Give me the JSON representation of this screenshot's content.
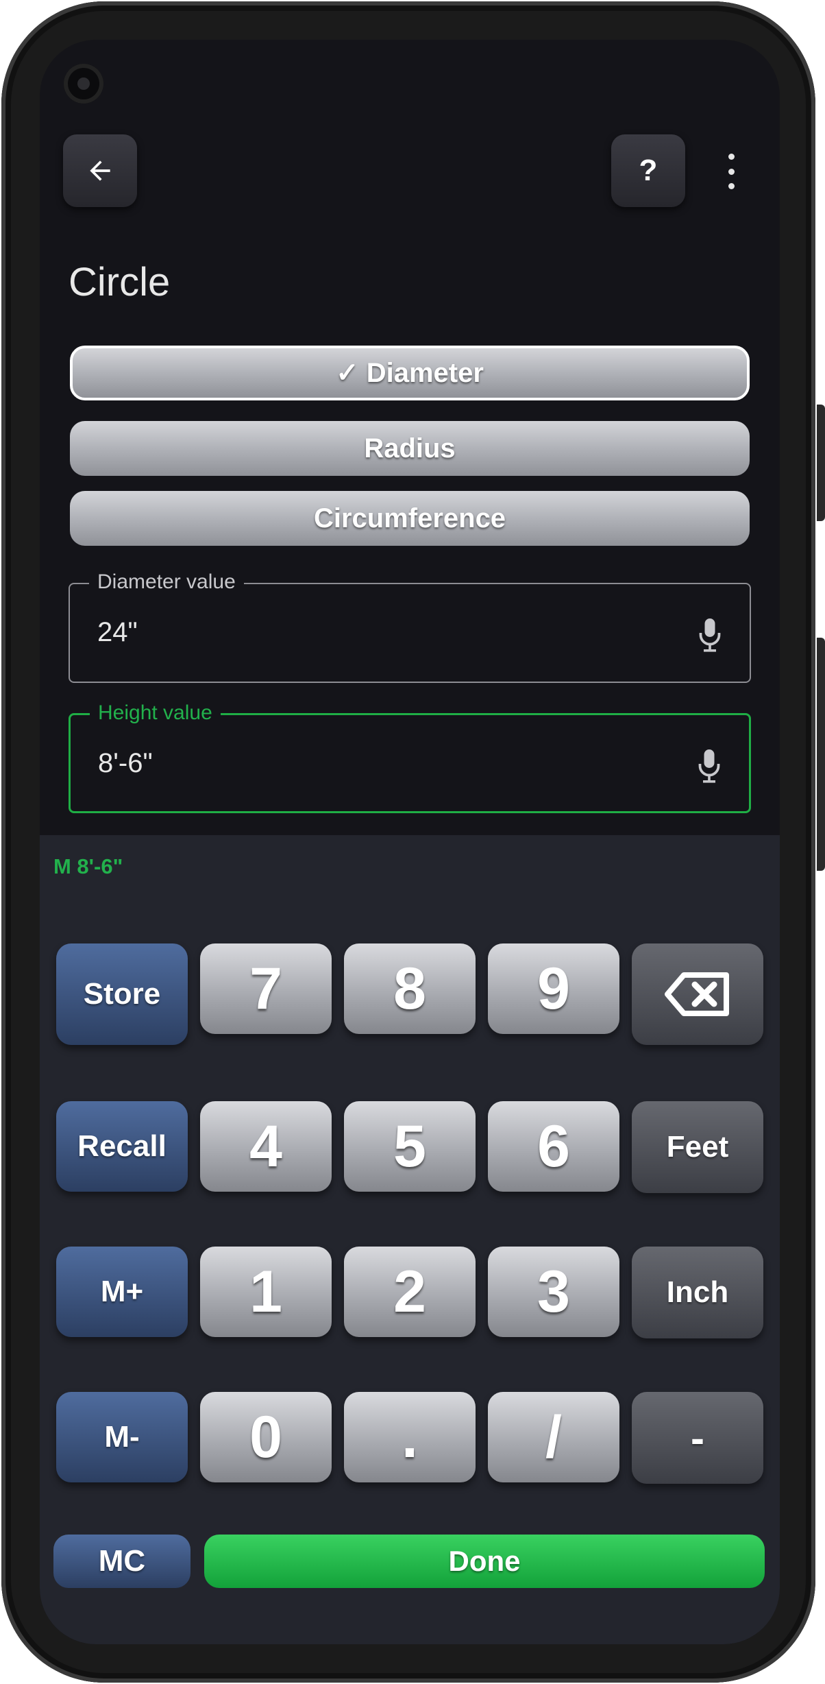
{
  "header": {
    "back_icon": "arrow-left-icon",
    "help_label": "?",
    "more_icon": "more-vert-icon"
  },
  "page": {
    "title": "Circle"
  },
  "segments": [
    {
      "label": "✓ Diameter",
      "selected": true
    },
    {
      "label": "Radius",
      "selected": false
    },
    {
      "label": "Circumference",
      "selected": false
    }
  ],
  "fields": {
    "diameter": {
      "label": "Diameter value",
      "value": "24\""
    },
    "height": {
      "label": "Height value",
      "value": "8'-6\""
    }
  },
  "memory_display": "M 8'-6\"",
  "keypad": {
    "store": "Store",
    "recall": "Recall",
    "m_plus": "M+",
    "m_minus": "M-",
    "mc": "MC",
    "digits": [
      "7",
      "8",
      "9",
      "4",
      "5",
      "6",
      "1",
      "2",
      "3",
      "0",
      ".",
      "/"
    ],
    "feet": "Feet",
    "inch": "Inch",
    "minus": "-",
    "done": "Done"
  },
  "colors": {
    "accent_green": "#22b14c",
    "memory_blue": "#3d5685",
    "background": "#141419"
  }
}
